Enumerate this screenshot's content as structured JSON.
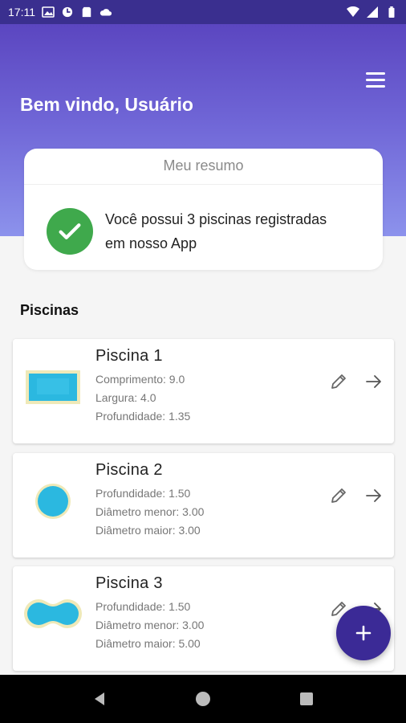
{
  "status_bar": {
    "time": "17:11"
  },
  "header": {
    "welcome": "Bem vindo, Usuário"
  },
  "summary": {
    "title": "Meu resumo",
    "message": "Você possui 3 piscinas registradas em nosso App"
  },
  "section_title": "Piscinas",
  "pools": [
    {
      "name": "Piscina 1",
      "attrs": [
        "Comprimento: 9.0",
        "Largura: 4.0",
        "Profundidade: 1.35"
      ]
    },
    {
      "name": "Piscina 2",
      "attrs": [
        "Profundidade: 1.50",
        "Diâmetro menor: 3.00",
        "Diâmetro maior: 3.00"
      ]
    },
    {
      "name": "Piscina 3",
      "attrs": [
        "Profundidade: 1.50",
        "Diâmetro menor: 3.00",
        "Diâmetro maior: 5.00"
      ]
    }
  ],
  "icons": {
    "menu": "menu-icon",
    "check": "check-icon",
    "edit": "pencil-icon",
    "forward": "arrow-right-icon",
    "add": "plus-icon"
  },
  "colors": {
    "primary": "#3b2a96",
    "header_top": "#5b46c0",
    "header_bottom": "#8c92ec",
    "success": "#3fa94c",
    "pool_water": "#2bb8e0"
  }
}
